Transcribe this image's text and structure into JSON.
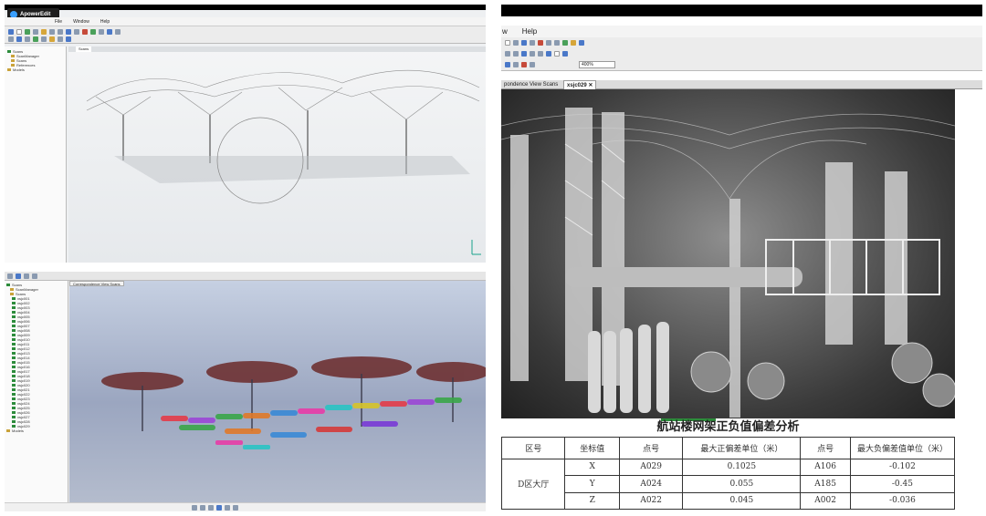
{
  "badge": {
    "label": "ApowerEdit"
  },
  "top_left": {
    "menu": [
      "File",
      "Window",
      "Help"
    ],
    "viewport_tab": "Scans",
    "tree": [
      "Scans",
      "ScanManager",
      "Scans",
      "References",
      "Models"
    ]
  },
  "bottom_left": {
    "viewport_tab": "Correspondence View Scans",
    "tree": [
      "Scans",
      "ScanManager",
      "Scans",
      "xsjc001",
      "xsjc002",
      "xsjc003",
      "xsjc004",
      "xsjc005",
      "xsjc006",
      "xsjc007",
      "xsjc008",
      "xsjc009",
      "xsjc010",
      "xsjc011",
      "xsjc012",
      "xsjc013",
      "xsjc014",
      "xsjc015",
      "xsjc016",
      "xsjc017",
      "xsjc018",
      "xsjc019",
      "xsjc020",
      "xsjc021",
      "xsjc022",
      "xsjc023",
      "xsjc024",
      "xsjc025",
      "xsjc026",
      "xsjc027",
      "xsjc028",
      "xsjc029",
      "Models"
    ]
  },
  "right": {
    "menu": [
      "w",
      "Help"
    ],
    "zoom": "400%",
    "tabs": [
      "pondence View Scans",
      "xsjc029"
    ],
    "table_title": "航站楼网架正负值偏差分析",
    "headers": [
      "区号",
      "坐标值",
      "点号",
      "最大正偏差单位（米）",
      "点号",
      "最大负偏差值单位（米）"
    ],
    "zone": "D区大厅",
    "rows": [
      [
        "X",
        "A029",
        "0.1025",
        "A106",
        "-0.102"
      ],
      [
        "Y",
        "A024",
        "0.055",
        "A185",
        "-0.45"
      ],
      [
        "Z",
        "A022",
        "0.045",
        "A002",
        "-0.036"
      ]
    ]
  }
}
